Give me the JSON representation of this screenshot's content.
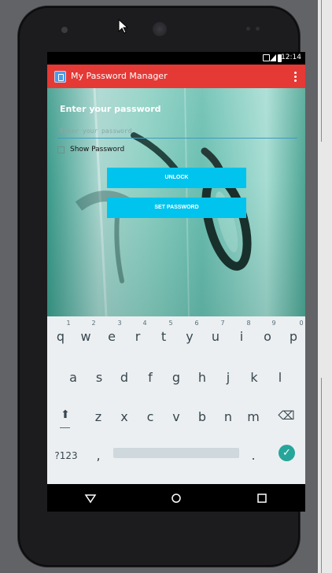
{
  "status_bar": {
    "clock": "12:14"
  },
  "app_bar": {
    "title": "My Password Manager"
  },
  "content": {
    "heading": "Enter your password",
    "password_placeholder": "Enter your password",
    "show_password_label": "Show Password",
    "unlock_label": "UNLOCK",
    "set_password_label": "SET PASSWORD"
  },
  "keyboard": {
    "row1": [
      "q",
      "w",
      "e",
      "r",
      "t",
      "y",
      "u",
      "i",
      "o",
      "p"
    ],
    "row1_hints": [
      "1",
      "2",
      "3",
      "4",
      "5",
      "6",
      "7",
      "8",
      "9",
      "0"
    ],
    "row2": [
      "a",
      "s",
      "d",
      "f",
      "g",
      "h",
      "j",
      "k",
      "l"
    ],
    "row3": [
      "z",
      "x",
      "c",
      "v",
      "b",
      "n",
      "m"
    ],
    "symbols_label": "?123",
    "comma": ",",
    "period": ".",
    "enter_icon": "check-icon"
  },
  "colors": {
    "app_bar": "#e53935",
    "button": "#00c4ee",
    "enter_key": "#26a69a"
  }
}
